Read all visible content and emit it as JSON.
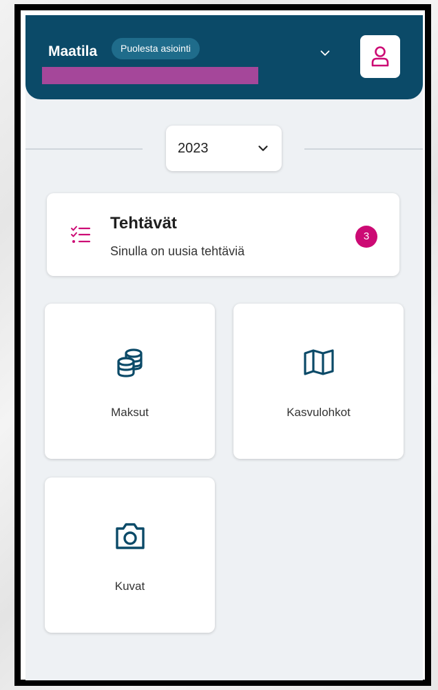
{
  "header": {
    "farm_name": "Maatila",
    "role_badge": "Puolesta asiointi",
    "colors": {
      "background": "#0b4a68",
      "redaction": "#a5479a"
    }
  },
  "year_selector": {
    "value": "2023"
  },
  "tasks": {
    "title": "Tehtävät",
    "subtitle": "Sinulla on uusia tehtäviä",
    "count": "3",
    "accent": "#cc0a74"
  },
  "tiles": [
    {
      "label": "Maksut",
      "icon": "coins-icon"
    },
    {
      "label": "Kasvulohkot",
      "icon": "map-icon"
    },
    {
      "label": "Kuvat",
      "icon": "camera-icon"
    }
  ]
}
